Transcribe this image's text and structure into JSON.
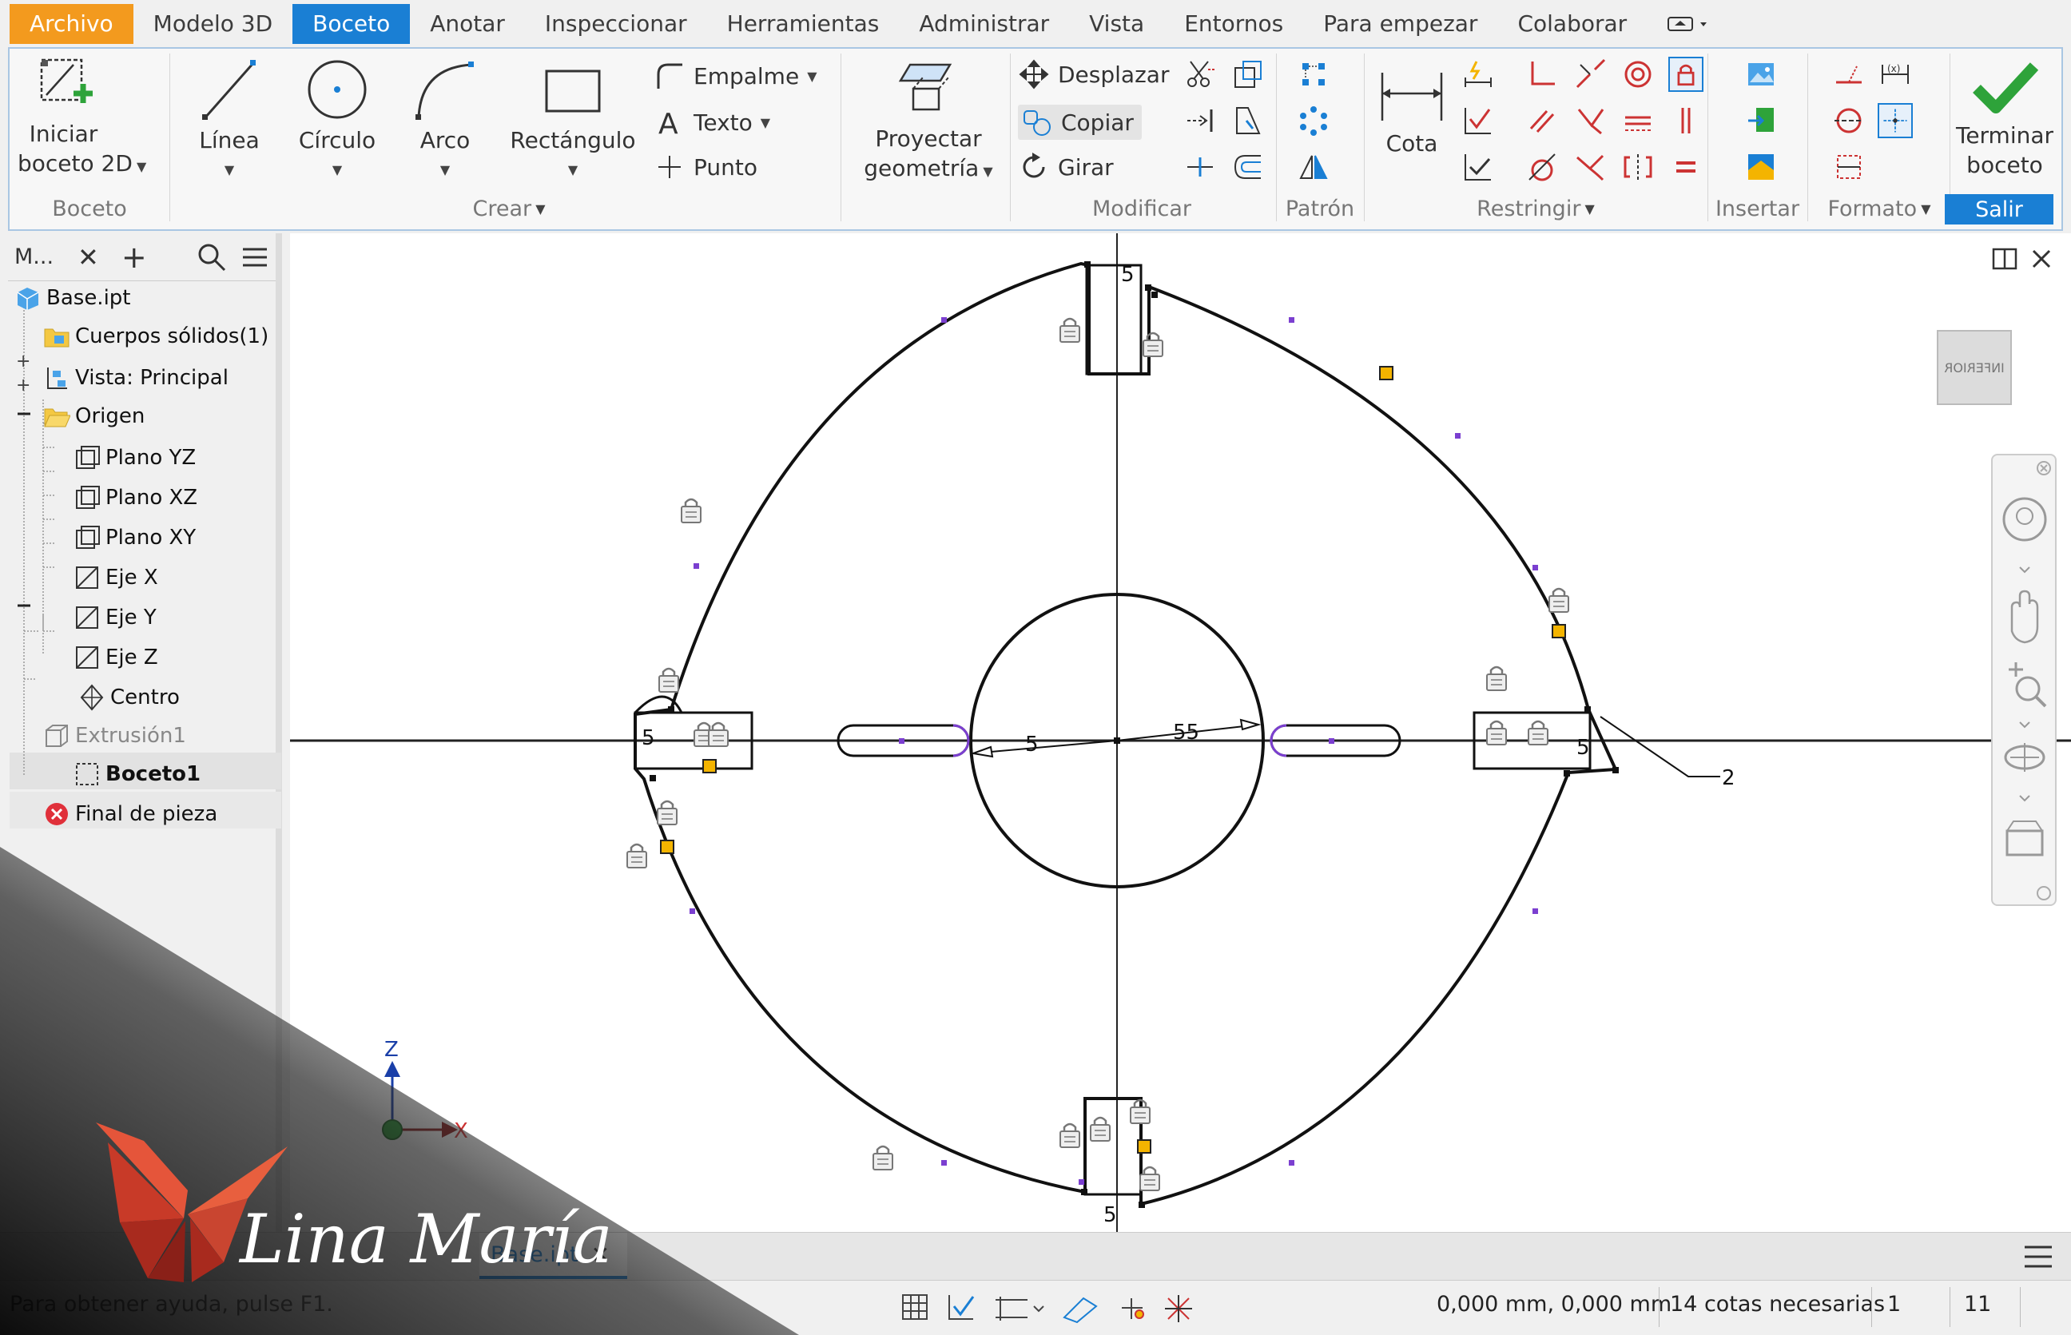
{
  "menu": {
    "file": "Archivo",
    "tabs": [
      "Modelo 3D",
      "Boceto",
      "Anotar",
      "Inspeccionar",
      "Herramientas",
      "Administrar",
      "Vista",
      "Entornos",
      "Para empezar",
      "Colaborar"
    ],
    "active": "Boceto"
  },
  "ribbon": {
    "iniciar_l1": "Iniciar",
    "iniciar_l2": "boceto 2D",
    "linea": "Línea",
    "circulo": "Círculo",
    "arco": "Arco",
    "rectangulo": "Rectángulo",
    "empalme": "Empalme",
    "texto": "Texto",
    "punto": "Punto",
    "proyectar_l1": "Proyectar",
    "proyectar_l2": "geometría",
    "desplazar": "Desplazar",
    "copiar": "Copiar",
    "girar": "Girar",
    "cota": "Cota",
    "terminar_l1": "Terminar",
    "terminar_l2": "boceto",
    "groups": {
      "boceto": "Boceto",
      "crear": "Crear",
      "modificar": "Modificar",
      "patron": "Patrón",
      "restringir": "Restringir",
      "insertar": "Insertar",
      "formato": "Formato",
      "salir": "Salir"
    }
  },
  "browser": {
    "tab": "M...",
    "items": {
      "base": "Base.ipt",
      "cuerpos": "Cuerpos sólidos(1)",
      "vista": "Vista: Principal",
      "origen": "Origen",
      "yz": "Plano YZ",
      "xz": "Plano XZ",
      "xy": "Plano XY",
      "ejex": "Eje X",
      "ejey": "Eje Y",
      "ejez": "Eje Z",
      "centro": "Centro",
      "extrusion": "Extrusión1",
      "boceto1": "Boceto1",
      "final": "Final de pieza"
    }
  },
  "canvas": {
    "dims": {
      "d5a": "5",
      "d5b": "5",
      "d5c": "5",
      "d5d": "5",
      "d5e": "5",
      "d55": "55",
      "d2": "2"
    },
    "viewcube": "INFERIOR",
    "axis_z": "Z",
    "axis_x": "X"
  },
  "doctab": {
    "name": "Base.ipt"
  },
  "status": {
    "help": "Para obtener ayuda, pulse F1.",
    "coords": "0,000 mm, 0,000 mm",
    "cotas": "14 cotas necesarias",
    "n1": "1",
    "n2": "11"
  },
  "watermark": {
    "text": "Lina María"
  },
  "colors": {
    "accent": "#1a7fd4",
    "file": "#f39a1e",
    "constraint": "#f4b400",
    "lock": "#888888"
  }
}
